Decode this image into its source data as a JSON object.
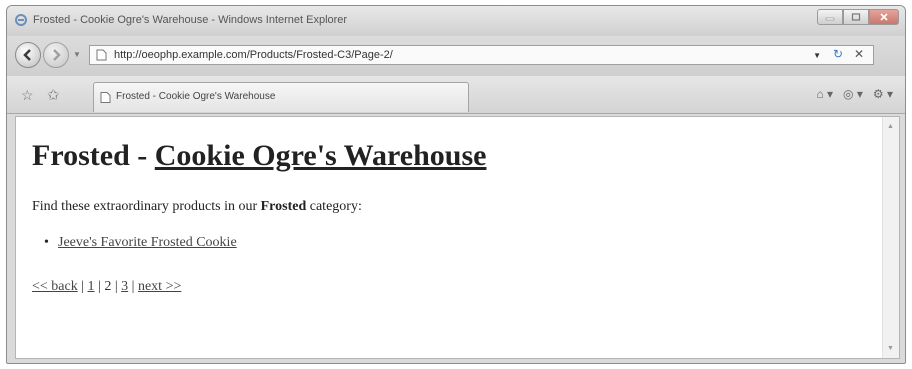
{
  "window": {
    "title": "Frosted - Cookie Ogre's Warehouse - Windows Internet Explorer"
  },
  "addressbar": {
    "url": "http://oeophp.example.com/Products/Frosted-C3/Page-2/"
  },
  "tabs": [
    {
      "label": "Frosted - Cookie Ogre's Warehouse"
    }
  ],
  "page": {
    "heading_category": "Frosted",
    "heading_separator": " - ",
    "heading_site": "Cookie Ogre's Warehouse",
    "intro_before": "Find these extraordinary products in our ",
    "intro_category": "Frosted",
    "intro_after": " category:",
    "products": [
      {
        "name": "Jeeve's Favorite Frosted Cookie"
      }
    ],
    "pager": {
      "back": "<< back",
      "sep": " | ",
      "pages": [
        "1",
        "2",
        "3"
      ],
      "next": "next >>"
    }
  },
  "icons": [
    "ie-logo-icon",
    "minimize-icon",
    "maximize-icon",
    "close-icon",
    "back-icon",
    "forward-icon",
    "page-icon",
    "refresh-icon",
    "stop-icon",
    "favorites-star-icon",
    "add-favorites-icon",
    "home-icon",
    "feeds-icon",
    "tools-icon"
  ]
}
